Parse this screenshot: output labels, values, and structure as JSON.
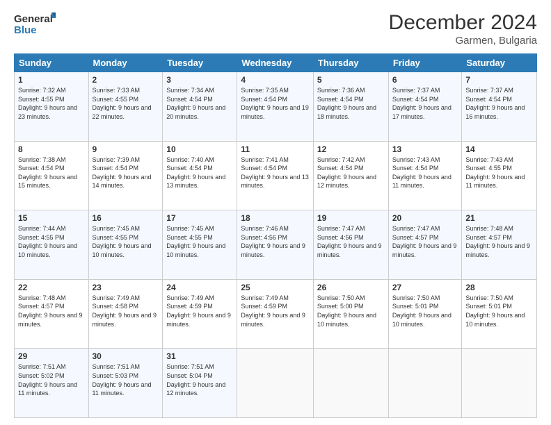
{
  "logo": {
    "line1": "General",
    "line2": "Blue"
  },
  "title": "December 2024",
  "subtitle": "Garmen, Bulgaria",
  "days_header": [
    "Sunday",
    "Monday",
    "Tuesday",
    "Wednesday",
    "Thursday",
    "Friday",
    "Saturday"
  ],
  "weeks": [
    [
      {
        "day": "1",
        "sunrise": "7:32 AM",
        "sunset": "4:55 PM",
        "daylight": "9 hours and 23 minutes."
      },
      {
        "day": "2",
        "sunrise": "7:33 AM",
        "sunset": "4:55 PM",
        "daylight": "9 hours and 22 minutes."
      },
      {
        "day": "3",
        "sunrise": "7:34 AM",
        "sunset": "4:54 PM",
        "daylight": "9 hours and 20 minutes."
      },
      {
        "day": "4",
        "sunrise": "7:35 AM",
        "sunset": "4:54 PM",
        "daylight": "9 hours and 19 minutes."
      },
      {
        "day": "5",
        "sunrise": "7:36 AM",
        "sunset": "4:54 PM",
        "daylight": "9 hours and 18 minutes."
      },
      {
        "day": "6",
        "sunrise": "7:37 AM",
        "sunset": "4:54 PM",
        "daylight": "9 hours and 17 minutes."
      },
      {
        "day": "7",
        "sunrise": "7:37 AM",
        "sunset": "4:54 PM",
        "daylight": "9 hours and 16 minutes."
      }
    ],
    [
      {
        "day": "8",
        "sunrise": "7:38 AM",
        "sunset": "4:54 PM",
        "daylight": "9 hours and 15 minutes."
      },
      {
        "day": "9",
        "sunrise": "7:39 AM",
        "sunset": "4:54 PM",
        "daylight": "9 hours and 14 minutes."
      },
      {
        "day": "10",
        "sunrise": "7:40 AM",
        "sunset": "4:54 PM",
        "daylight": "9 hours and 13 minutes."
      },
      {
        "day": "11",
        "sunrise": "7:41 AM",
        "sunset": "4:54 PM",
        "daylight": "9 hours and 13 minutes."
      },
      {
        "day": "12",
        "sunrise": "7:42 AM",
        "sunset": "4:54 PM",
        "daylight": "9 hours and 12 minutes."
      },
      {
        "day": "13",
        "sunrise": "7:43 AM",
        "sunset": "4:54 PM",
        "daylight": "9 hours and 11 minutes."
      },
      {
        "day": "14",
        "sunrise": "7:43 AM",
        "sunset": "4:55 PM",
        "daylight": "9 hours and 11 minutes."
      }
    ],
    [
      {
        "day": "15",
        "sunrise": "7:44 AM",
        "sunset": "4:55 PM",
        "daylight": "9 hours and 10 minutes."
      },
      {
        "day": "16",
        "sunrise": "7:45 AM",
        "sunset": "4:55 PM",
        "daylight": "9 hours and 10 minutes."
      },
      {
        "day": "17",
        "sunrise": "7:45 AM",
        "sunset": "4:55 PM",
        "daylight": "9 hours and 10 minutes."
      },
      {
        "day": "18",
        "sunrise": "7:46 AM",
        "sunset": "4:56 PM",
        "daylight": "9 hours and 9 minutes."
      },
      {
        "day": "19",
        "sunrise": "7:47 AM",
        "sunset": "4:56 PM",
        "daylight": "9 hours and 9 minutes."
      },
      {
        "day": "20",
        "sunrise": "7:47 AM",
        "sunset": "4:57 PM",
        "daylight": "9 hours and 9 minutes."
      },
      {
        "day": "21",
        "sunrise": "7:48 AM",
        "sunset": "4:57 PM",
        "daylight": "9 hours and 9 minutes."
      }
    ],
    [
      {
        "day": "22",
        "sunrise": "7:48 AM",
        "sunset": "4:57 PM",
        "daylight": "9 hours and 9 minutes."
      },
      {
        "day": "23",
        "sunrise": "7:49 AM",
        "sunset": "4:58 PM",
        "daylight": "9 hours and 9 minutes."
      },
      {
        "day": "24",
        "sunrise": "7:49 AM",
        "sunset": "4:59 PM",
        "daylight": "9 hours and 9 minutes."
      },
      {
        "day": "25",
        "sunrise": "7:49 AM",
        "sunset": "4:59 PM",
        "daylight": "9 hours and 9 minutes."
      },
      {
        "day": "26",
        "sunrise": "7:50 AM",
        "sunset": "5:00 PM",
        "daylight": "9 hours and 10 minutes."
      },
      {
        "day": "27",
        "sunrise": "7:50 AM",
        "sunset": "5:01 PM",
        "daylight": "9 hours and 10 minutes."
      },
      {
        "day": "28",
        "sunrise": "7:50 AM",
        "sunset": "5:01 PM",
        "daylight": "9 hours and 10 minutes."
      }
    ],
    [
      {
        "day": "29",
        "sunrise": "7:51 AM",
        "sunset": "5:02 PM",
        "daylight": "9 hours and 11 minutes."
      },
      {
        "day": "30",
        "sunrise": "7:51 AM",
        "sunset": "5:03 PM",
        "daylight": "9 hours and 11 minutes."
      },
      {
        "day": "31",
        "sunrise": "7:51 AM",
        "sunset": "5:04 PM",
        "daylight": "9 hours and 12 minutes."
      },
      null,
      null,
      null,
      null
    ]
  ],
  "labels": {
    "sunrise": "Sunrise:",
    "sunset": "Sunset:",
    "daylight": "Daylight:"
  }
}
